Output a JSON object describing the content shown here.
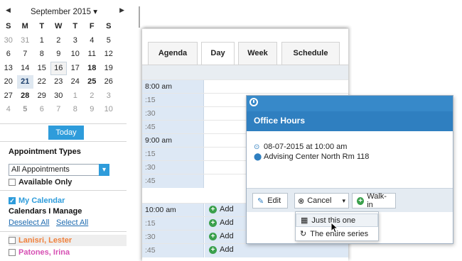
{
  "calendar": {
    "month_label": "September 2015 ▾",
    "prev_icon": "◀",
    "next_icon": "▶",
    "weekdays": [
      "S",
      "M",
      "T",
      "W",
      "T",
      "F",
      "S"
    ],
    "weeks": [
      [
        "30",
        "31",
        "1",
        "2",
        "3",
        "4",
        "5"
      ],
      [
        "6",
        "7",
        "8",
        "9",
        "10",
        "11",
        "12"
      ],
      [
        "13",
        "14",
        "15",
        "16",
        "17",
        "18",
        "19"
      ],
      [
        "20",
        "21",
        "22",
        "23",
        "24",
        "25",
        "26"
      ],
      [
        "27",
        "28",
        "29",
        "30",
        "1",
        "2",
        "3"
      ],
      [
        "4",
        "5",
        "6",
        "7",
        "8",
        "9",
        "10"
      ]
    ],
    "today_button": "Today"
  },
  "appointment_types": {
    "title": "Appointment Types",
    "selected": "All Appointments",
    "available_only": "Available Only"
  },
  "my_calendar": "My Calendar",
  "calendars_manage": {
    "title": "Calendars I Manage",
    "deselect_all": "Deselect All",
    "select_all": "Select All",
    "people": [
      {
        "name": "Lanisri, Lester",
        "color": "#f0813c"
      },
      {
        "name": "Patones, Irina",
        "color": "#d64fb3"
      }
    ]
  },
  "tabs": [
    "Agenda",
    "Day",
    "Week",
    "Schedule"
  ],
  "times": [
    {
      "label": "8:00 am",
      "minor": false,
      "add": false
    },
    {
      "label": ":15",
      "minor": true,
      "add": false
    },
    {
      "label": ":30",
      "minor": true,
      "add": false
    },
    {
      "label": ":45",
      "minor": true,
      "add": false
    },
    {
      "label": "9:00 am",
      "minor": false,
      "add": false
    },
    {
      "label": ":15",
      "minor": true,
      "add": false
    },
    {
      "label": ":30",
      "minor": true,
      "add": false
    },
    {
      "label": ":45",
      "minor": true,
      "add": false
    },
    {
      "label": "10:00 am",
      "minor": false,
      "add": true
    },
    {
      "label": ":15",
      "minor": true,
      "add": true
    },
    {
      "label": ":30",
      "minor": true,
      "add": true
    },
    {
      "label": ":45",
      "minor": true,
      "add": true
    }
  ],
  "add_label": "Add",
  "popup": {
    "title": "Office Hours",
    "datetime": "08-07-2015 at 10:00 am",
    "location": "Advising Center North Rm 118",
    "edit": "Edit",
    "cancel": "Cancel",
    "walkin": "Walk-in",
    "menu": [
      "Just this one",
      "The entire series"
    ]
  },
  "colors": {
    "accent": "#2e9cdb",
    "popup_header": "#2f7fc0",
    "add_green": "#3aa04c"
  }
}
